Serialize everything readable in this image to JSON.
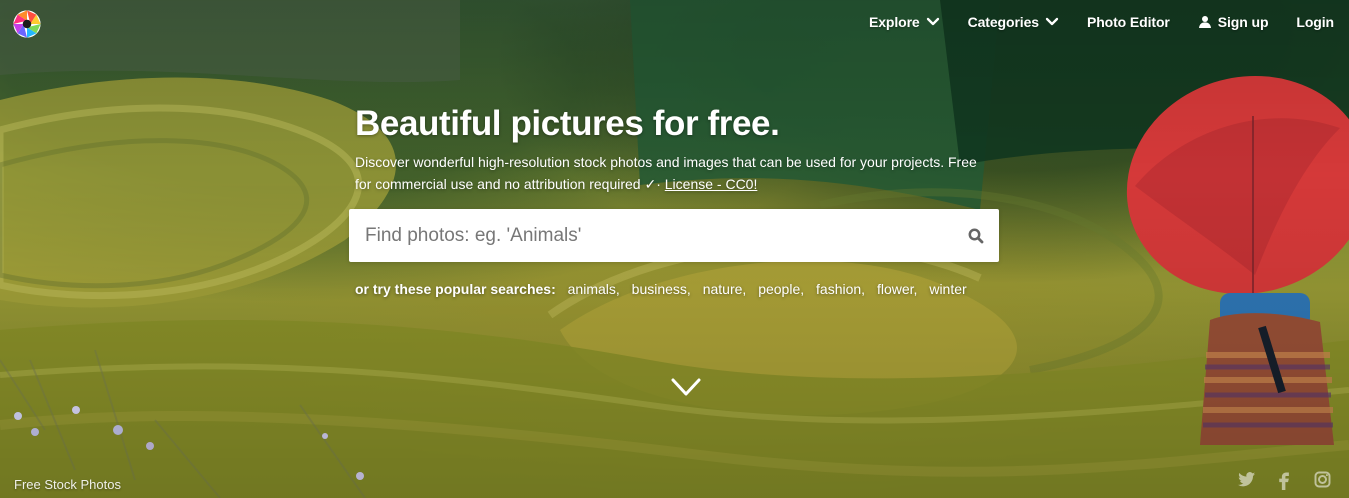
{
  "nav": {
    "explore": "Explore",
    "categories": "Categories",
    "photo_editor": "Photo Editor",
    "sign_up": "Sign up",
    "login": "Login"
  },
  "hero": {
    "title": "Beautiful pictures for free.",
    "description": "Discover wonderful high-resolution stock photos and images that can be used for your projects. Free for commercial use and no attribution required ✓·",
    "license_link": "License - CC0!"
  },
  "search": {
    "placeholder": "Find photos: eg. 'Animals'"
  },
  "popular": {
    "label": "or try these popular searches:",
    "items": [
      "animals,",
      "business,",
      "nature,",
      "people,",
      "fashion,",
      "flower,",
      "winter"
    ]
  },
  "footer": {
    "brand": "Free Stock Photos"
  },
  "icons": {
    "logo": "camera-aperture-icon",
    "explore": "chevron-down-icon",
    "categories": "chevron-down-icon",
    "signup": "user-icon",
    "search": "search-icon",
    "scroll": "chevron-down-icon",
    "social": [
      "twitter-icon",
      "facebook-icon",
      "instagram-icon"
    ]
  },
  "colors": {
    "white": "#ffffff",
    "search_background": "#ffffff",
    "field_green": "#8c8f2e",
    "umbrella_red": "#d93a3a"
  }
}
